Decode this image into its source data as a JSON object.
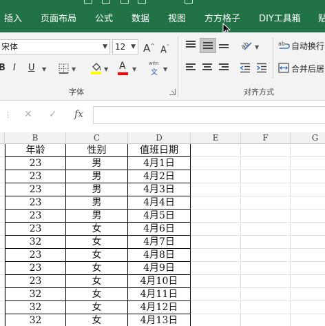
{
  "ribbon_tabs": [
    "插入",
    "页面布局",
    "公式",
    "数据",
    "视图",
    "方方格子",
    "DIY工具箱",
    "贴"
  ],
  "font_group": {
    "font_name": "宋体",
    "font_size": "12",
    "grow_font": "A",
    "shrink_font": "A",
    "bold": "B",
    "italic": "I",
    "underline": "U",
    "font_color_letter": "A",
    "phonetic_label": "wén",
    "phonetic_char": "文",
    "group_label": "字体",
    "highlight_color": "#ffff00",
    "font_color": "#ff0000"
  },
  "align_group": {
    "wrap_text": "自动换行",
    "merge_center": "合并后居",
    "group_label": "对齐方式"
  },
  "formula_bar": {
    "cancel_icon": "✕",
    "enter_icon": "✓",
    "fx_label": "fx",
    "value": ""
  },
  "columns": [
    "B",
    "C",
    "D",
    "E",
    "F",
    "G"
  ],
  "table": {
    "headers": [
      "年龄",
      "性别",
      "值班日期"
    ],
    "rows": [
      [
        "23",
        "男",
        "4月1日"
      ],
      [
        "23",
        "男",
        "4月2日"
      ],
      [
        "23",
        "男",
        "4月3日"
      ],
      [
        "23",
        "男",
        "4月4日"
      ],
      [
        "23",
        "男",
        "4月5日"
      ],
      [
        "23",
        "女",
        "4月6日"
      ],
      [
        "32",
        "女",
        "4月7日"
      ],
      [
        "23",
        "女",
        "4月8日"
      ],
      [
        "23",
        "女",
        "4月9日"
      ],
      [
        "23",
        "女",
        "4月10日"
      ],
      [
        "32",
        "女",
        "4月11日"
      ],
      [
        "32",
        "女",
        "4月12日"
      ],
      [
        "32",
        "女",
        "4月13日"
      ]
    ]
  },
  "colors": {
    "excel_green": "#217346",
    "ribbon_bg": "#f3f3f3",
    "selected_align": "#c5c5c5"
  }
}
